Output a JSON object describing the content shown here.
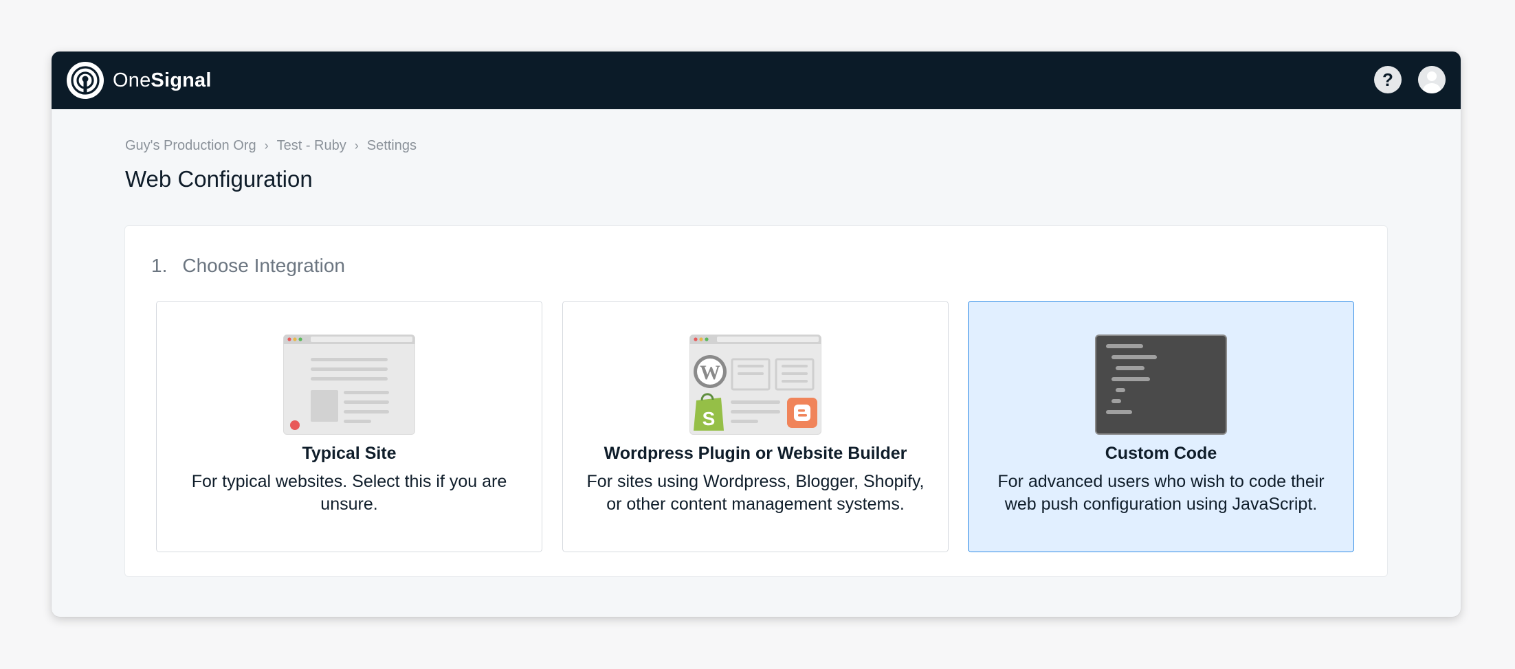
{
  "brand": {
    "name_part1": "One",
    "name_part2": "Signal"
  },
  "header": {
    "help_label": "?"
  },
  "breadcrumb": {
    "items": [
      "Guy's Production Org",
      "Test - Ruby",
      "Settings"
    ],
    "separator": "›"
  },
  "page": {
    "title": "Web Configuration"
  },
  "step": {
    "number": "1.",
    "title": "Choose Integration"
  },
  "options": [
    {
      "title": "Typical Site",
      "description": "For typical websites. Select this if you are unsure.",
      "icon": "browser-page-icon",
      "selected": false
    },
    {
      "title": "Wordpress Plugin or Website Builder",
      "description": "For sites using Wordpress, Blogger, Shopify, or other content management systems.",
      "icon": "cms-builder-icon",
      "selected": false
    },
    {
      "title": "Custom Code",
      "description": "For advanced users who wish to code their web push configuration using JavaScript.",
      "icon": "code-editor-icon",
      "selected": true
    }
  ],
  "colors": {
    "topbar": "#0b1b28",
    "selected_bg": "#e1efff",
    "selected_border": "#2b8ae6"
  }
}
